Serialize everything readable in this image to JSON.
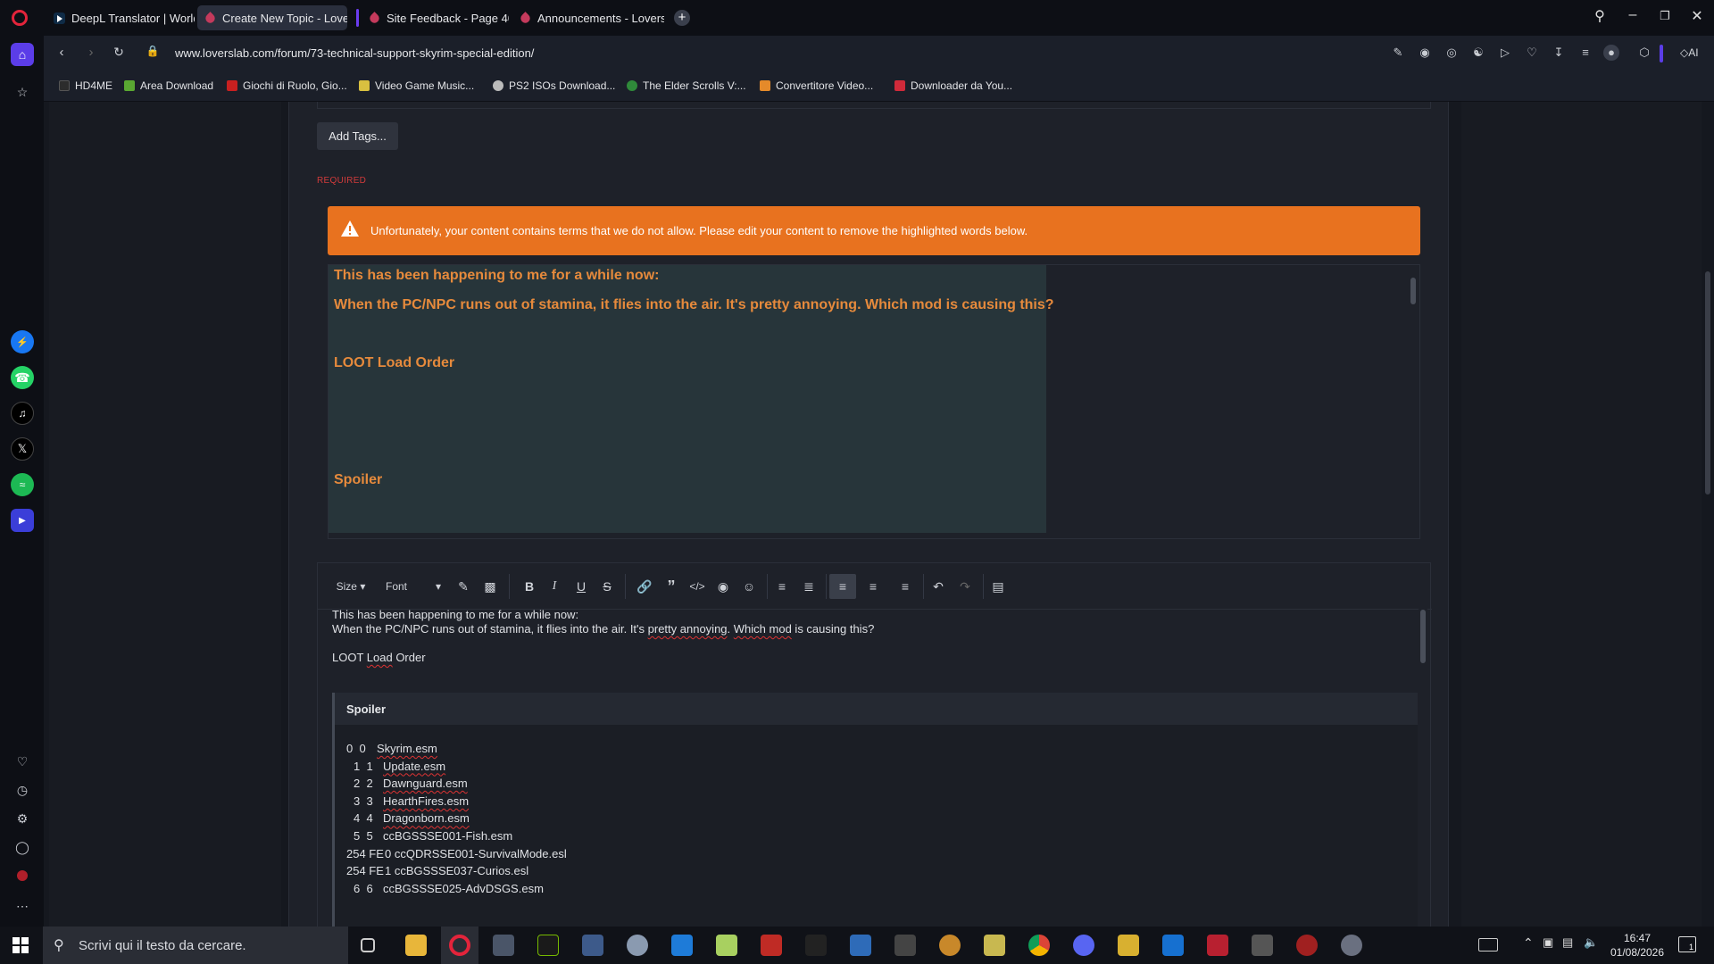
{
  "tabs": [
    {
      "label": "DeepL Translator | World's",
      "active": false
    },
    {
      "label": "Create New Topic - Lovers",
      "active": true
    },
    {
      "label": "Site Feedback - Page 40 -",
      "active": false
    },
    {
      "label": "Announcements - LoversL",
      "active": false
    }
  ],
  "address": {
    "url": "www.loverslab.com/forum/73-technical-support-skyrim-special-edition/",
    "ai_label": "AI"
  },
  "bookmarks": [
    {
      "label": "HD4ME",
      "color": "#333"
    },
    {
      "label": "Area Download",
      "color": "#5aa832"
    },
    {
      "label": "Giochi di Ruolo, Gio...",
      "color": "#c82020"
    },
    {
      "label": "Video Game Music...",
      "color": "#d8c040"
    },
    {
      "label": "PS2 ISOs Download...",
      "color": "#bbbbbb"
    },
    {
      "label": "The Elder Scrolls V:...",
      "color": "#2f8a3a"
    },
    {
      "label": "Convertitore Video...",
      "color": "#e58a2a"
    },
    {
      "label": "Downloader da You...",
      "color": "#d02a3a"
    }
  ],
  "form": {
    "add_tags_label": "Add Tags...",
    "required_label": "REQUIRED",
    "warning_text": "Unfortunately, your content contains terms that we do not allow. Please edit your content to remove the highlighted words below."
  },
  "preview": {
    "line1": "This has been happening to me for a while now:",
    "line2": "When the PC/NPC runs out of stamina, it flies into the air. It's pretty annoying. Which mod is causing this?",
    "line3": "LOOT Load Order",
    "line4": "Spoiler"
  },
  "toolbar": {
    "size_label": "Size",
    "font_label": "Font"
  },
  "editor": {
    "line1": "This has been happening to me for a while now:",
    "line2_a": "When the PC/NPC runs out of stamina, it flies into the air. It's ",
    "line2_b": "pretty annoying",
    "line2_c": ". ",
    "line2_d": "Which mod",
    "line2_e": " is causing this?",
    "line3_a": "LOOT ",
    "line3_b": "Load",
    "line3_c": " Order",
    "spoiler_title": "Spoiler",
    "load_order": [
      {
        "idx": "0  0",
        "name": "Skyrim.esm"
      },
      {
        "idx": "1  1",
        "name": "Update.esm"
      },
      {
        "idx": "2  2",
        "name": "Dawnguard.esm"
      },
      {
        "idx": "3  3",
        "name": "HearthFires.esm"
      },
      {
        "idx": "4  4",
        "name": "Dragonborn.esm"
      },
      {
        "idx": "5  5",
        "name": "ccBGSSSE001-Fish.esm"
      },
      {
        "idx": "254 FE",
        "name": "0 ccQDRSSE001-SurvivalMode.esl"
      },
      {
        "idx": "254 FE",
        "name": "1 ccBGSSSE037-Curios.esl"
      },
      {
        "idx": "6  6",
        "name": "ccBGSSSE025-AdvDSGS.esm"
      }
    ]
  },
  "taskbar": {
    "search_placeholder": "Scrivi qui il testo da cercare.",
    "time": "16:47",
    "date": "01/08/2026",
    "notif_count": "1"
  }
}
